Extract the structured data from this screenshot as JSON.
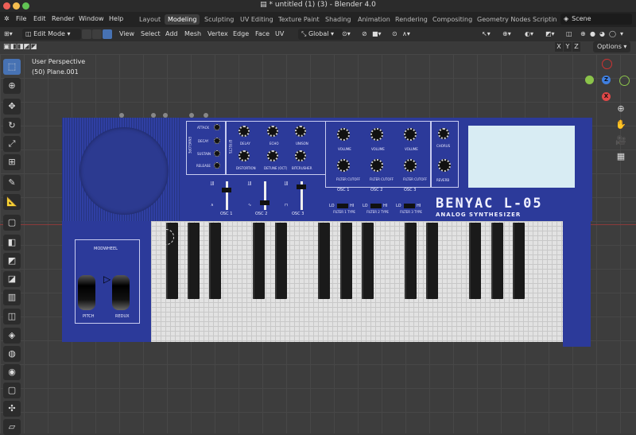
{
  "window": {
    "title": "* untitled (1) (3) - Blender 4.0"
  },
  "menus": [
    "File",
    "Edit",
    "Render",
    "Window",
    "Help"
  ],
  "workspaces": [
    "Layout",
    "Modeling",
    "Sculpting",
    "UV Editing",
    "Texture Paint",
    "Shading",
    "Animation",
    "Rendering",
    "Compositing",
    "Geometry Nodes",
    "Scriptin"
  ],
  "active_workspace": "Modeling",
  "scene": "Scene",
  "header": {
    "mode": "Edit Mode",
    "menus": [
      "View",
      "Select",
      "Add",
      "Mesh",
      "Vertex",
      "Edge",
      "Face",
      "UV"
    ],
    "orientation": "Global"
  },
  "toolbar_right": {
    "options": "Options",
    "axes": [
      "X",
      "Y",
      "Z"
    ]
  },
  "viewport": {
    "view_name": "User Perspective",
    "object_info": "(50) Plane.001"
  },
  "gizmo": {
    "y": "Y",
    "z": "Z",
    "x": "X"
  },
  "synth": {
    "envelope": "ENVELOPE",
    "env_labels": [
      "ATTACK",
      "DECAY",
      "SUSTAIN",
      "RELEASE"
    ],
    "effects": "EFFECTS",
    "fx_labels": [
      "DELAY",
      "ECHO",
      "UNISON",
      "DISTORTION",
      "DETUNE (OCT)",
      "BITCRUSHER"
    ],
    "osc_labels": [
      "VOLUME",
      "VOLUME",
      "VOLUME",
      "FILTER CUTOFF",
      "FILTER CUTOFF",
      "FILTER CUTOFF"
    ],
    "osc_names": [
      "OSC 1",
      "OSC 2",
      "OSC 3"
    ],
    "fx2": [
      "CHORUS",
      "REVERB"
    ],
    "osc_bottom": [
      "OSC 1",
      "OSC 2",
      "OSC 3"
    ],
    "filter_types": [
      "FILTER 1 TYPE",
      "FILTER 2 TYPE",
      "FILTER 3 TYPE"
    ],
    "lo": "LO",
    "hi": "HI",
    "brand": "BENYAC L-05",
    "subtitle": "ANALOG SYNTHESIZER",
    "modwheel": "MODWHEEL",
    "pitch": "PITCH",
    "redux": "REDUX"
  }
}
